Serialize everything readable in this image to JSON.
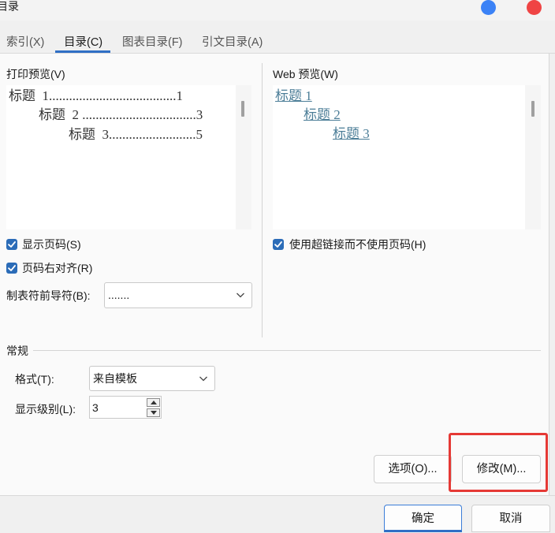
{
  "window": {
    "title": "目录"
  },
  "tabs": [
    {
      "label": "索引(X)"
    },
    {
      "label": "目录(C)"
    },
    {
      "label": "图表目录(F)"
    },
    {
      "label": "引文目录(A)"
    }
  ],
  "print_preview": {
    "label": "打印预览(V)",
    "lines": [
      {
        "text": "标题",
        "num": "1",
        "dots": "......................................",
        "page": "1"
      },
      {
        "text": "标题",
        "num": "2",
        "dots": "..................................",
        "page": "3"
      },
      {
        "text": "标题",
        "num": "3",
        "dots": "..........................",
        "page": "5"
      }
    ]
  },
  "web_preview": {
    "label": "Web 预览(W)",
    "links": [
      "标题 1",
      "标题 2",
      "标题 3"
    ]
  },
  "options": {
    "show_page_numbers": {
      "label": "显示页码(S)",
      "checked": true
    },
    "right_align": {
      "label": "页码右对齐(R)",
      "checked": true
    },
    "use_hyperlinks": {
      "label": "使用超链接而不使用页码(H)",
      "checked": true
    },
    "tab_leader": {
      "label": "制表符前导符(B):",
      "value": "......."
    }
  },
  "general": {
    "heading": "常规",
    "format": {
      "label": "格式(T):",
      "value": "来自模板"
    },
    "levels": {
      "label": "显示级别(L):",
      "value": "3"
    }
  },
  "buttons": {
    "options": "选项(O)...",
    "modify": "修改(M)...",
    "ok": "确定",
    "cancel": "取消"
  },
  "colors": {
    "accent": "#2b6cb8",
    "highlight": "#e53935",
    "window_dot_blue": "#3b82f6",
    "window_dot_red": "#ef4444"
  }
}
